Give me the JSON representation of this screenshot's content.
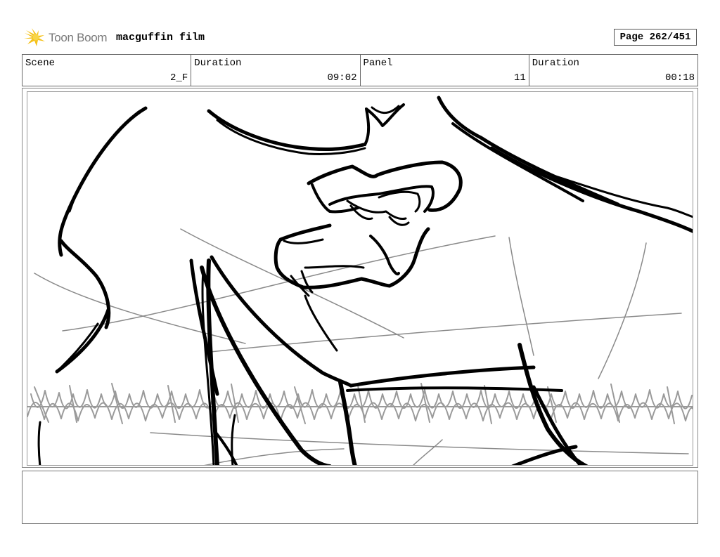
{
  "header": {
    "logo_text": "Toon Boom",
    "project_title": "macguffin film",
    "page_indicator": "Page 262/451"
  },
  "info": {
    "scene_label": "Scene",
    "scene_value": "2_F",
    "scene_duration_label": "Duration",
    "scene_duration_value": "09:02",
    "panel_label": "Panel",
    "panel_value": "11",
    "panel_duration_label": "Duration",
    "panel_duration_value": "00:18"
  },
  "colors": {
    "logo_yellow": "#f5c21b",
    "logo_text": "#7a7a7a",
    "ink": "#000000",
    "guide_gray": "#8a8a8a"
  },
  "notes": {
    "text": ""
  }
}
